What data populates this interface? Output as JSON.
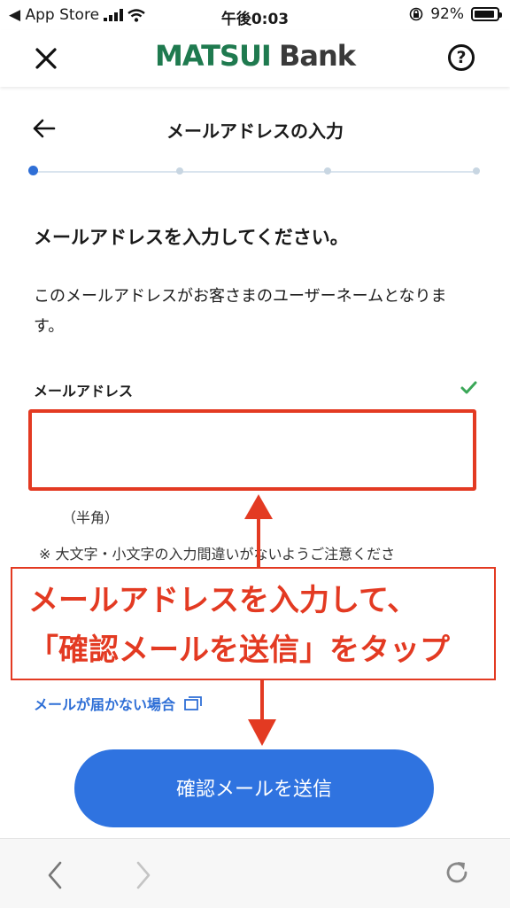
{
  "status_bar": {
    "back_app": "◀ App Store",
    "time": "午後0:03",
    "battery": "92%",
    "battery_level": 0.92
  },
  "header": {
    "logo_brand": "MATSUI",
    "logo_bank": "Bank",
    "help_label": "?"
  },
  "page": {
    "title": "メールアドレスの入力",
    "step_count": 4,
    "current_step": 1
  },
  "content": {
    "headline": "メールアドレスを入力してください。",
    "description": "このメールアドレスがお客さまのユーザーネームとなります。",
    "field_label": "メールアドレス",
    "email_value": "",
    "hankaku": "（半角）",
    "note": "※ 大文字・小文字の入力間違いがないようご注意くださ",
    "help_link": "メールが届かない場合",
    "submit": "確認メールを送信"
  },
  "annotation": {
    "line1": "メールアドレスを入力して、",
    "line2": "「確認メールを送信」をタップ",
    "color": "#e33a22"
  },
  "colors": {
    "accent": "#2f73e0",
    "brand_green": "#1f7a4f"
  }
}
